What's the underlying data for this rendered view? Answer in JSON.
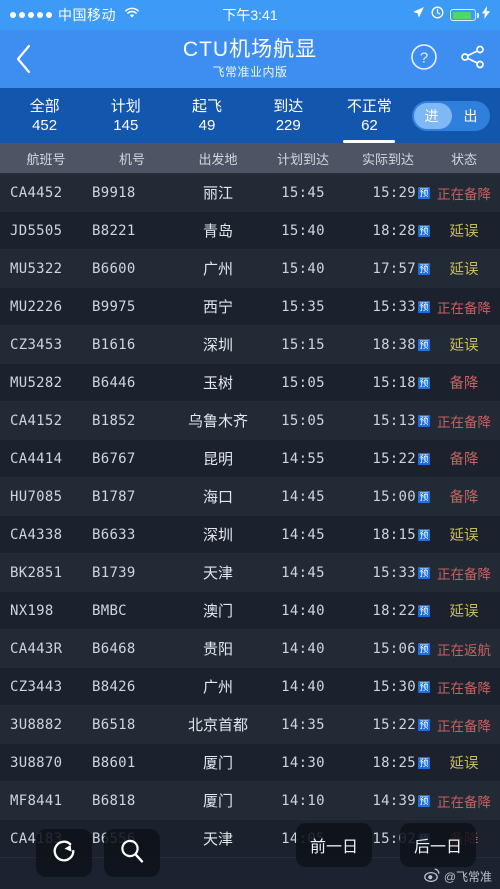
{
  "status_bar": {
    "carrier": "中国移动",
    "signal_dots": 5,
    "wifi_icon": "wifi-icon",
    "time": "下午3:41",
    "location_icon": "location-arrow-icon",
    "alarm_icon": "alarm-clock-icon",
    "battery_icon": "battery-icon",
    "battery_level_pct": 88,
    "charging_icon": "lightning-bolt-icon",
    "battery_color": "#4cd964"
  },
  "nav": {
    "back_icon": "chevron-left-icon",
    "title": "CTU机场航显",
    "subtitle": "飞常准业内版",
    "help_icon": "question-circle-icon",
    "share_icon": "share-icon",
    "bg_color": "#3d8ef0"
  },
  "tabs": {
    "bg_color": "#1356ad",
    "items": [
      {
        "label": "全部",
        "count": "452",
        "active": false
      },
      {
        "label": "计划",
        "count": "145",
        "active": false
      },
      {
        "label": "起飞",
        "count": "49",
        "active": false
      },
      {
        "label": "到达",
        "count": "229",
        "active": false
      },
      {
        "label": "不正常",
        "count": "62",
        "active": true
      }
    ],
    "toggle": {
      "left_label": "进",
      "right_label": "出",
      "selected": "进"
    }
  },
  "table": {
    "headers": [
      "航班号",
      "机号",
      "出发地",
      "计划到达",
      "实际到达",
      "状态"
    ],
    "header_bg": "#4d5463",
    "status_colors": {
      "delay": "#c9bf55",
      "alert": "#c6615f"
    },
    "estimate_badge": "预",
    "rows": [
      {
        "flight": "CA4452",
        "tail": "B9918",
        "from": "丽江",
        "sched": "15:45",
        "actual": "15:29",
        "est": true,
        "status": "正在备降",
        "status_type": "alert"
      },
      {
        "flight": "JD5505",
        "tail": "B8221",
        "from": "青岛",
        "sched": "15:40",
        "actual": "18:28",
        "est": true,
        "status": "延误",
        "status_type": "delay"
      },
      {
        "flight": "MU5322",
        "tail": "B6600",
        "from": "广州",
        "sched": "15:40",
        "actual": "17:57",
        "est": true,
        "status": "延误",
        "status_type": "delay"
      },
      {
        "flight": "MU2226",
        "tail": "B9975",
        "from": "西宁",
        "sched": "15:35",
        "actual": "15:33",
        "est": true,
        "status": "正在备降",
        "status_type": "alert"
      },
      {
        "flight": "CZ3453",
        "tail": "B1616",
        "from": "深圳",
        "sched": "15:15",
        "actual": "18:38",
        "est": true,
        "status": "延误",
        "status_type": "delay"
      },
      {
        "flight": "MU5282",
        "tail": "B6446",
        "from": "玉树",
        "sched": "15:05",
        "actual": "15:18",
        "est": true,
        "status": "备降",
        "status_type": "alert"
      },
      {
        "flight": "CA4152",
        "tail": "B1852",
        "from": "乌鲁木齐",
        "sched": "15:05",
        "actual": "15:13",
        "est": true,
        "status": "正在备降",
        "status_type": "alert"
      },
      {
        "flight": "CA4414",
        "tail": "B6767",
        "from": "昆明",
        "sched": "14:55",
        "actual": "15:22",
        "est": true,
        "status": "备降",
        "status_type": "alert"
      },
      {
        "flight": "HU7085",
        "tail": "B1787",
        "from": "海口",
        "sched": "14:45",
        "actual": "15:00",
        "est": true,
        "status": "备降",
        "status_type": "alert"
      },
      {
        "flight": "CA4338",
        "tail": "B6633",
        "from": "深圳",
        "sched": "14:45",
        "actual": "18:15",
        "est": true,
        "status": "延误",
        "status_type": "delay"
      },
      {
        "flight": "BK2851",
        "tail": "B1739",
        "from": "天津",
        "sched": "14:45",
        "actual": "15:33",
        "est": true,
        "status": "正在备降",
        "status_type": "alert"
      },
      {
        "flight": "NX198",
        "tail": "BMBC",
        "from": "澳门",
        "sched": "14:40",
        "actual": "18:22",
        "est": true,
        "status": "延误",
        "status_type": "delay"
      },
      {
        "flight": "CA443R",
        "tail": "B6468",
        "from": "贵阳",
        "sched": "14:40",
        "actual": "15:06",
        "est": true,
        "status": "正在返航",
        "status_type": "alert"
      },
      {
        "flight": "CZ3443",
        "tail": "B8426",
        "from": "广州",
        "sched": "14:40",
        "actual": "15:30",
        "est": true,
        "status": "正在备降",
        "status_type": "alert"
      },
      {
        "flight": "3U8882",
        "tail": "B6518",
        "from": "北京首都",
        "sched": "14:35",
        "actual": "15:22",
        "est": true,
        "status": "正在备降",
        "status_type": "alert"
      },
      {
        "flight": "3U8870",
        "tail": "B8601",
        "from": "厦门",
        "sched": "14:30",
        "actual": "18:25",
        "est": true,
        "status": "延误",
        "status_type": "delay"
      },
      {
        "flight": "MF8441",
        "tail": "B6818",
        "from": "厦门",
        "sched": "14:10",
        "actual": "14:39",
        "est": true,
        "status": "正在备降",
        "status_type": "alert"
      },
      {
        "flight": "CA4183",
        "tail": "B6556",
        "from": "天津",
        "sched": "14:05",
        "actual": "15:02",
        "est": true,
        "status": "备降",
        "status_type": "alert"
      }
    ]
  },
  "floating": {
    "refresh_icon": "refresh-icon",
    "search_icon": "search-icon",
    "prev_day_label": "前一日",
    "next_day_label": "后一日"
  },
  "watermark": {
    "icon": "weibo-icon",
    "text": "@飞常准"
  }
}
